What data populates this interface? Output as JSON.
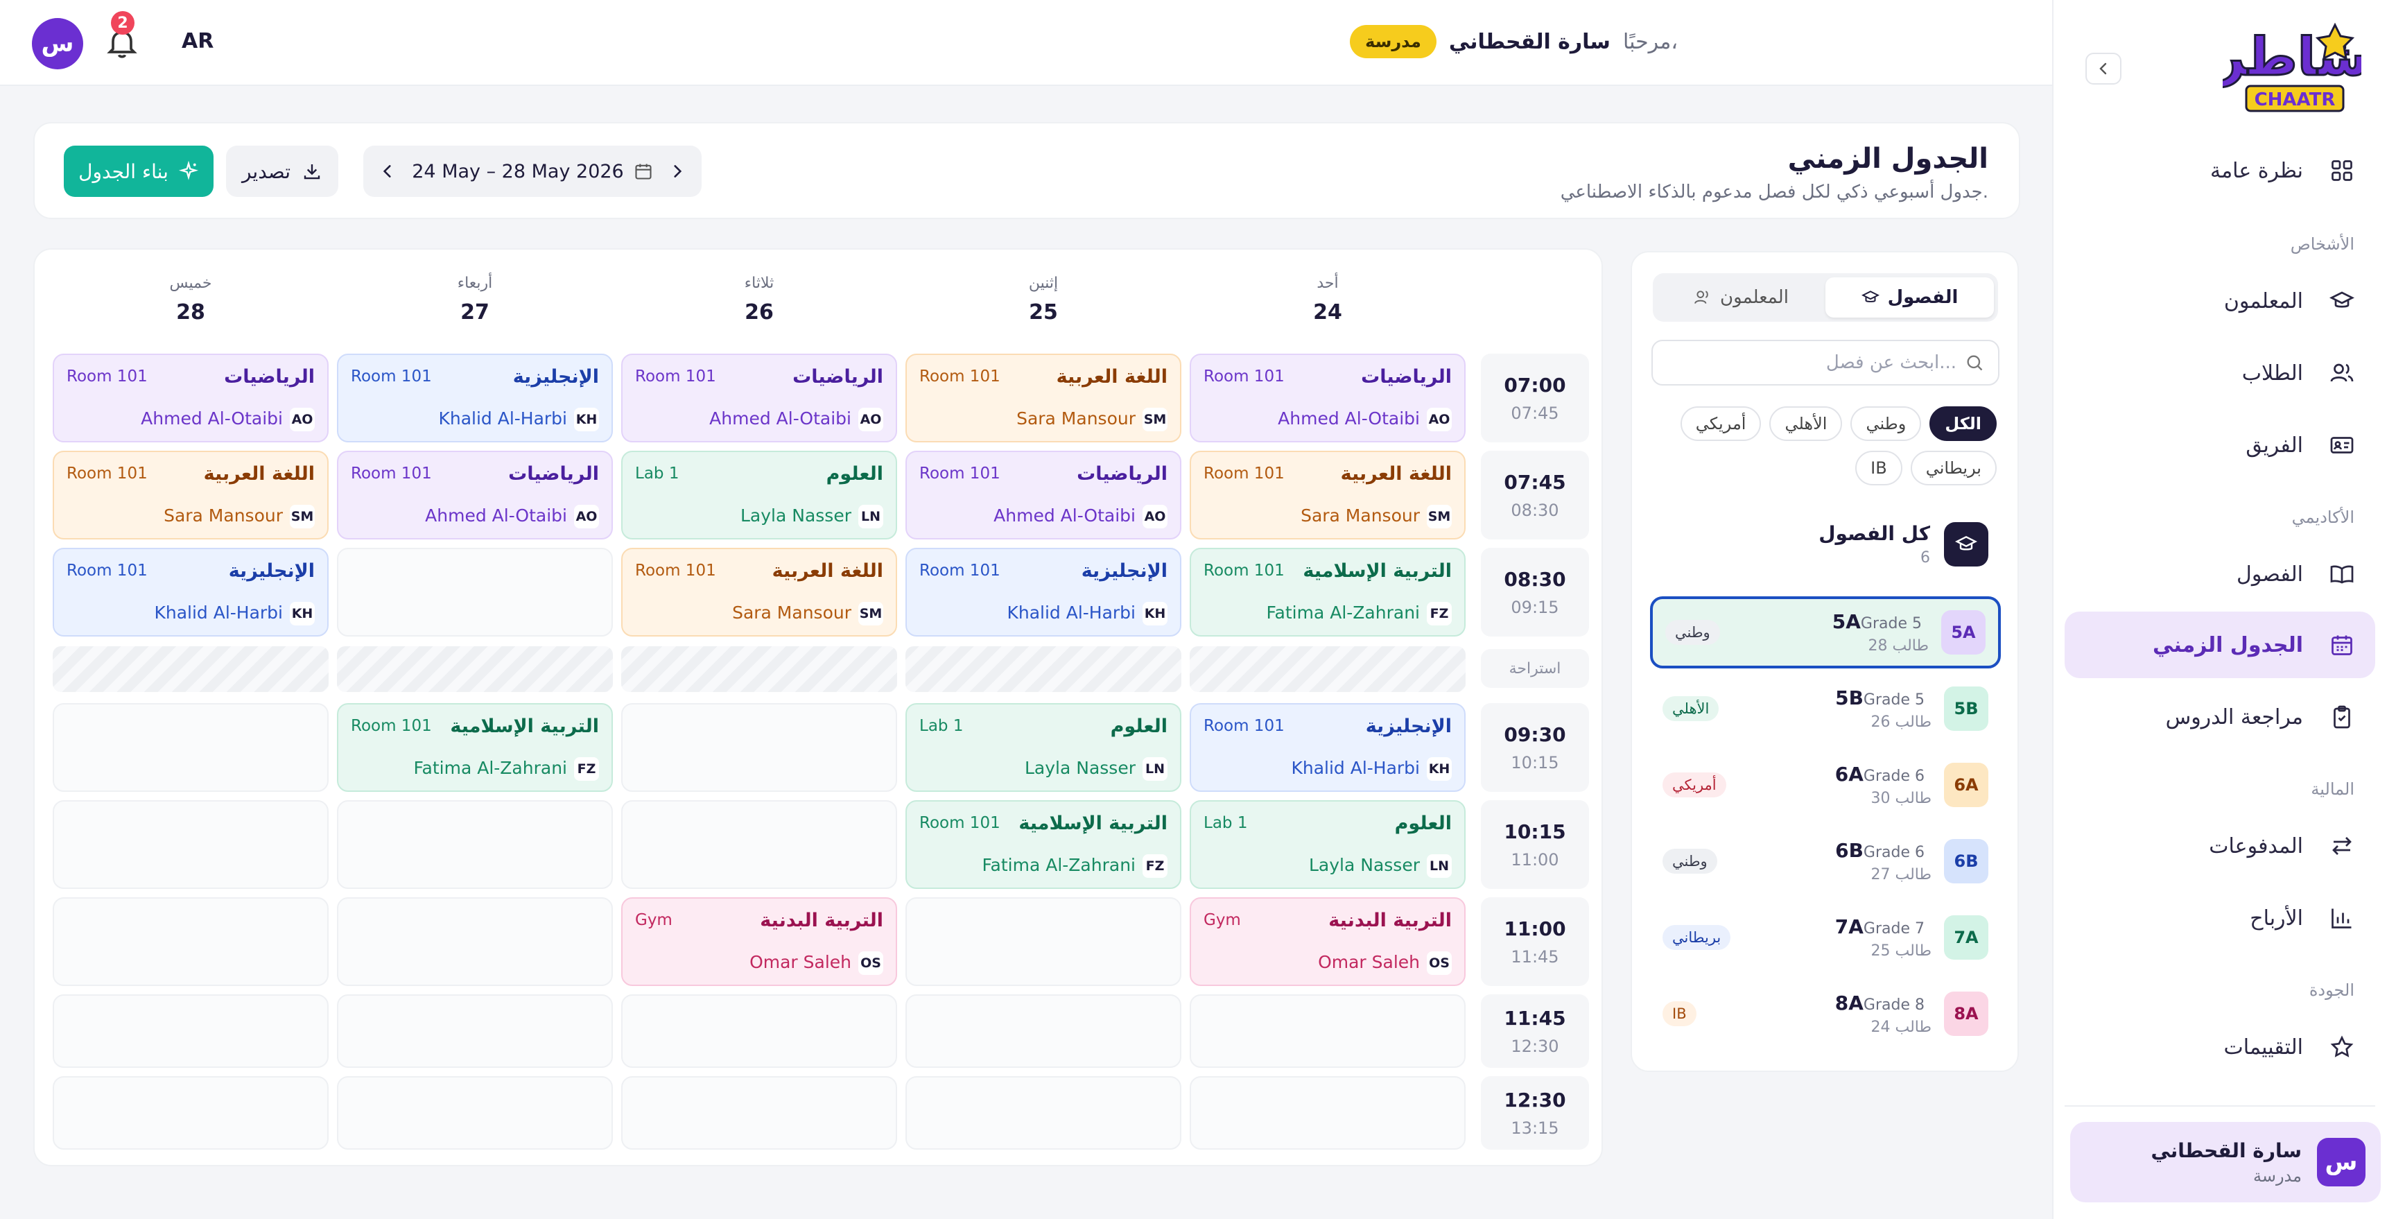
{
  "topbar": {
    "avatar_initial": "س",
    "notifications_count": "2",
    "language": "AR",
    "welcome": "مرحبًا،",
    "user_name": "سارة القحطاني",
    "school_badge": "مدرسة"
  },
  "sidebar": {
    "logo_text": "CHAATR",
    "logo_arabic": "شاطر",
    "nav": [
      {
        "label": "نظرة عامة",
        "icon": "grid-icon",
        "active": false
      },
      {
        "label": "المعلمون",
        "icon": "graduation-cap-icon",
        "active": false
      },
      {
        "label": "الطلاب",
        "icon": "users-icon",
        "active": false
      },
      {
        "label": "الفريق",
        "icon": "id-card-icon",
        "active": false
      },
      {
        "label": "الفصول",
        "icon": "book-open-icon",
        "active": false
      },
      {
        "label": "الجدول الزمني",
        "icon": "calendar-icon",
        "active": true
      },
      {
        "label": "مراجعة الدروس",
        "icon": "clipboard-check-icon",
        "active": false
      },
      {
        "label": "المدفوعات",
        "icon": "arrows-exchange-icon",
        "active": false
      },
      {
        "label": "الأرباح",
        "icon": "bar-chart-icon",
        "active": false
      },
      {
        "label": "التقييمات",
        "icon": "star-icon",
        "active": false
      }
    ],
    "sections": [
      "الأشخاص",
      "الأكاديمي",
      "المالية",
      "الجودة"
    ],
    "user": {
      "initial": "س",
      "name": "سارة القحطاني",
      "role": "مدرسة"
    }
  },
  "header": {
    "title": "الجدول الزمني",
    "subtitle": "جدول أسبوعي ذكي لكل فصل مدعوم بالذكاء الاصطناعي.",
    "date_range": "24 May – 28 May 2026",
    "export_label": "تصدير",
    "build_label": "بناء الجدول"
  },
  "class_panel": {
    "tab_classes": "الفصول",
    "tab_teachers": "المعلمون",
    "search_placeholder": "ابحث عن فصل...",
    "filters": [
      "الكل",
      "وطني",
      "الأهلي",
      "أمريكي",
      "بريطاني",
      "IB"
    ],
    "all_classes_label": "كل الفصول",
    "all_classes_count": "6",
    "classes": [
      {
        "code": "5A",
        "grade": "Grade 5",
        "students": "28 طالب",
        "tag": "وطني",
        "selected": true
      },
      {
        "code": "5B",
        "grade": "Grade 5",
        "students": "26 طالب",
        "tag": "الأهلي",
        "selected": false
      },
      {
        "code": "6A",
        "grade": "Grade 6",
        "students": "30 طالب",
        "tag": "أمريكي",
        "selected": false
      },
      {
        "code": "6B",
        "grade": "Grade 6",
        "students": "27 طالب",
        "tag": "وطني",
        "selected": false
      },
      {
        "code": "7A",
        "grade": "Grade 7",
        "students": "25 طالب",
        "tag": "بريطاني",
        "selected": false
      },
      {
        "code": "8A",
        "grade": "Grade 8",
        "students": "24 طالب",
        "tag": "IB",
        "selected": false
      }
    ]
  },
  "timetable": {
    "days": [
      {
        "name": "أحد",
        "date": "24"
      },
      {
        "name": "إثنين",
        "date": "25"
      },
      {
        "name": "ثلاثاء",
        "date": "26"
      },
      {
        "name": "أربعاء",
        "date": "27"
      },
      {
        "name": "خميس",
        "date": "28"
      }
    ],
    "break_label": "استراحة",
    "slots": [
      {
        "start": "07:00",
        "end": "07:45",
        "type": "lesson"
      },
      {
        "start": "07:45",
        "end": "08:30",
        "type": "lesson"
      },
      {
        "start": "08:30",
        "end": "09:15",
        "type": "lesson"
      },
      {
        "type": "break"
      },
      {
        "start": "09:30",
        "end": "10:15",
        "type": "lesson"
      },
      {
        "start": "10:15",
        "end": "11:00",
        "type": "lesson"
      },
      {
        "start": "11:00",
        "end": "11:45",
        "type": "lesson"
      },
      {
        "start": "11:45",
        "end": "12:30",
        "type": "lesson"
      },
      {
        "start": "12:30",
        "end": "13:15",
        "type": "lesson"
      }
    ],
    "lessons": [
      [
        {
          "subject": "الرياضيات",
          "room": "Room 101",
          "teacher": "Ahmed Al-Otaibi",
          "initials": "AO",
          "kind": "math"
        },
        {
          "subject": "اللغة العربية",
          "room": "Room 101",
          "teacher": "Sara Mansour",
          "initials": "SM",
          "kind": "arabic"
        },
        {
          "subject": "الرياضيات",
          "room": "Room 101",
          "teacher": "Ahmed Al-Otaibi",
          "initials": "AO",
          "kind": "math"
        },
        {
          "subject": "الإنجليزية",
          "room": "Room 101",
          "teacher": "Khalid Al-Harbi",
          "initials": "KH",
          "kind": "english"
        },
        {
          "subject": "الرياضيات",
          "room": "Room 101",
          "teacher": "Ahmed Al-Otaibi",
          "initials": "AO",
          "kind": "math"
        }
      ],
      [
        {
          "subject": "اللغة العربية",
          "room": "Room 101",
          "teacher": "Sara Mansour",
          "initials": "SM",
          "kind": "arabic"
        },
        {
          "subject": "الرياضيات",
          "room": "Room 101",
          "teacher": "Ahmed Al-Otaibi",
          "initials": "AO",
          "kind": "math"
        },
        {
          "subject": "العلوم",
          "room": "Lab 1",
          "teacher": "Layla Nasser",
          "initials": "LN",
          "kind": "science"
        },
        {
          "subject": "الرياضيات",
          "room": "Room 101",
          "teacher": "Ahmed Al-Otaibi",
          "initials": "AO",
          "kind": "math"
        },
        {
          "subject": "اللغة العربية",
          "room": "Room 101",
          "teacher": "Sara Mansour",
          "initials": "SM",
          "kind": "arabic"
        }
      ],
      [
        {
          "subject": "التربية الإسلامية",
          "room": "Room 101",
          "teacher": "Fatima Al-Zahrani",
          "initials": "FZ",
          "kind": "islamic"
        },
        {
          "subject": "الإنجليزية",
          "room": "Room 101",
          "teacher": "Khalid Al-Harbi",
          "initials": "KH",
          "kind": "english"
        },
        {
          "subject": "اللغة العربية",
          "room": "Room 101",
          "teacher": "Sara Mansour",
          "initials": "SM",
          "kind": "arabic"
        },
        null,
        {
          "subject": "الإنجليزية",
          "room": "Room 101",
          "teacher": "Khalid Al-Harbi",
          "initials": "KH",
          "kind": "english"
        }
      ],
      [
        null,
        null,
        null,
        null,
        null
      ],
      [
        {
          "subject": "الإنجليزية",
          "room": "Room 101",
          "teacher": "Khalid Al-Harbi",
          "initials": "KH",
          "kind": "english"
        },
        {
          "subject": "العلوم",
          "room": "Lab 1",
          "teacher": "Layla Nasser",
          "initials": "LN",
          "kind": "science"
        },
        null,
        {
          "subject": "التربية الإسلامية",
          "room": "Room 101",
          "teacher": "Fatima Al-Zahrani",
          "initials": "FZ",
          "kind": "islamic"
        },
        null
      ],
      [
        {
          "subject": "العلوم",
          "room": "Lab 1",
          "teacher": "Layla Nasser",
          "initials": "LN",
          "kind": "science"
        },
        {
          "subject": "التربية الإسلامية",
          "room": "Room 101",
          "teacher": "Fatima Al-Zahrani",
          "initials": "FZ",
          "kind": "islamic"
        },
        null,
        null,
        null
      ],
      [
        {
          "subject": "التربية البدنية",
          "room": "Gym",
          "teacher": "Omar Saleh",
          "initials": "OS",
          "kind": "pe"
        },
        null,
        {
          "subject": "التربية البدنية",
          "room": "Gym",
          "teacher": "Omar Saleh",
          "initials": "OS",
          "kind": "pe"
        },
        null,
        null
      ],
      [
        null,
        null,
        null,
        null,
        null
      ],
      [
        null,
        null,
        null,
        null,
        null
      ]
    ]
  },
  "colors": {
    "math": {
      "bg": "#f3ecfd",
      "border": "#e3d3fa",
      "subject": "#4a1f9e",
      "text": "#6b35c9"
    },
    "arabic": {
      "bg": "#fff4e6",
      "border": "#fbdcb4",
      "subject": "#8a3c05",
      "text": "#b25a10"
    },
    "english": {
      "bg": "#ebf2ff",
      "border": "#cfdcfb",
      "subject": "#1b3ea8",
      "text": "#2a55c7"
    },
    "science": {
      "bg": "#e8f7f1",
      "border": "#c6ebdb",
      "subject": "#0c6b4b",
      "text": "#178a62"
    },
    "islamic": {
      "bg": "#e8f7f1",
      "border": "#c6ebdb",
      "subject": "#0c6b4b",
      "text": "#178a62"
    },
    "pe": {
      "bg": "#fdebf3",
      "border": "#f8c9dd",
      "subject": "#9b1250",
      "text": "#c2285f"
    },
    "primary": "#11b59a",
    "accent": "#6b2fd1"
  }
}
